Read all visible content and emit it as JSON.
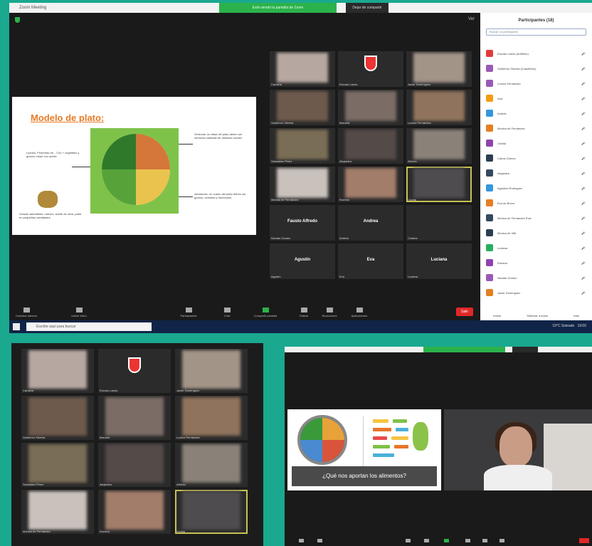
{
  "top": {
    "window_title": "Zoom Meeting",
    "share_bar": "Está viendo la pantalla de Zoom",
    "stop_share": "Dejar de compartir",
    "view_label": "Ver",
    "slide": {
      "title": "Modelo de plato:",
      "left_text": "Lípidos: Proteínas de... Con + vegetales y granos mejor con aceite",
      "right_top_text": "Verduras: la mitad del plato deben ser verduras variadas de distintos colores",
      "right_bottom_text": "Almidones: un cuarto del plato deben ser granos, cereales y tubérculos",
      "bottom_left_text": "Grasas saludables: nueces, aceite de oliva, palta en pequeñas cantidades"
    },
    "gallery": [
      {
        "name": "Carolina"
      },
      {
        "name": "Escudo Lanús"
      },
      {
        "name": "Javier Domínguez"
      },
      {
        "name": "Guillermo Silveira"
      },
      {
        "name": "Marcela"
      },
      {
        "name": "Lorena Fernández"
      },
      {
        "name": "Sebastián Pérez"
      },
      {
        "name": "Alejandra"
      },
      {
        "name": "Alfredo"
      },
      {
        "name": "Mónica de Fernández"
      },
      {
        "name": "Romina"
      },
      {
        "name": "Cecilia"
      },
      {
        "name": "Nicolás Gómez"
      },
      {
        "name": "Andrea"
      },
      {
        "name": "Cristina"
      },
      {
        "name": "Agustín"
      },
      {
        "name": "Eva"
      },
      {
        "name": "Luciana"
      }
    ],
    "big_names": [
      "Fausto Alfredo",
      "Andrea",
      "Agustín",
      "Eva",
      "Luciana"
    ],
    "toolbar": {
      "mute": "Cancelar silencio",
      "video": "Iniciar video",
      "participants": "Participantes",
      "chat": "Chat",
      "share": "Compartir pantalla",
      "record": "Grabar",
      "reactions": "Reacciones",
      "apps": "Aplicaciones",
      "end": "Salir"
    },
    "taskbar": {
      "search": "Escribe aquí para buscar",
      "weather": "19°C Soleado",
      "time": "19:00"
    },
    "participants_panel": {
      "title": "Participantes (18)",
      "search_placeholder": "Buscar un participante",
      "list": [
        {
          "name": "Escudo Lanús (Anfitrión)",
          "color": "#e33b3b"
        },
        {
          "name": "Guillermo Silveira (Coanfitrión)",
          "color": "#9b59b6"
        },
        {
          "name": "Lorena Fernández",
          "color": "#9b59b6"
        },
        {
          "name": "Ana",
          "color": "#f39c12"
        },
        {
          "name": "Andrés",
          "color": "#3498db"
        },
        {
          "name": "Mónica de Fernández",
          "color": "#e67e22"
        },
        {
          "name": "Cecilia",
          "color": "#8e44ad"
        },
        {
          "name": "Carlos Gómez",
          "color": "#2c3e50"
        },
        {
          "name": "Alejandra",
          "color": "#34495e"
        },
        {
          "name": "Agustina Rodríguez",
          "color": "#3498db"
        },
        {
          "name": "Eva de Bruno",
          "color": "#e67e22"
        },
        {
          "name": "Mónica de Fernández Ruiz",
          "color": "#34495e"
        },
        {
          "name": "Mónica de Vitti",
          "color": "#2c3e50"
        },
        {
          "name": "Luciana",
          "color": "#27ae60"
        },
        {
          "name": "Romina",
          "color": "#8e44ad"
        },
        {
          "name": "Nicolás Gómez",
          "color": "#9b59b6"
        },
        {
          "name": "Javier Domínguez",
          "color": "#e67e22"
        }
      ],
      "footer": [
        "Invitar",
        "Silenciar a todos",
        "Más"
      ]
    }
  },
  "bottom_left": {
    "gallery": [
      {
        "name": "Carolina"
      },
      {
        "name": "Escudo Lanús"
      },
      {
        "name": "Javier Domínguez"
      },
      {
        "name": "Guillermo Silveira"
      },
      {
        "name": "Marcela"
      },
      {
        "name": "Lorena Fernández"
      },
      {
        "name": "Sebastián Pérez"
      },
      {
        "name": "Alejandra"
      },
      {
        "name": "Alfredo"
      },
      {
        "name": "Mónica de Fernández"
      },
      {
        "name": "Romina"
      },
      {
        "name": "Cecilia"
      }
    ]
  },
  "bottom_right": {
    "banner": "¿Qué nos aportan los alimentos?"
  },
  "colors": {
    "background": "#1aa88f",
    "zoom_green": "#2bb24c",
    "end_red": "#e02828",
    "slide_title": "#e87b27"
  },
  "icons": [
    "shield-icon",
    "microphone-icon",
    "camera-icon",
    "participants-icon",
    "chat-icon",
    "share-screen-icon",
    "record-icon",
    "reactions-icon",
    "apps-icon",
    "windows-start-icon",
    "search-icon"
  ]
}
